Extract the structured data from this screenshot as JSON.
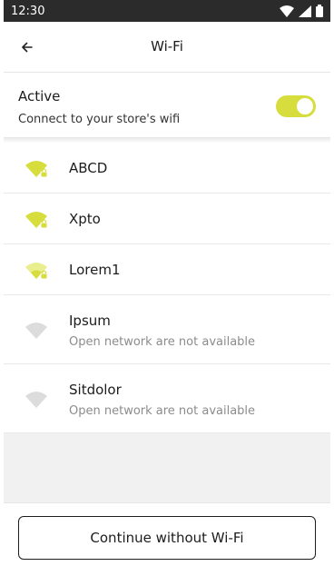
{
  "status_bar": {
    "time": "12:30"
  },
  "header": {
    "title": "Wi-Fi"
  },
  "active": {
    "label": "Active",
    "description": "Connect to your store's wifi",
    "toggle_on": true
  },
  "colors": {
    "accent": "#d6dd3c",
    "accent_light": "#e9ee8f",
    "disabled": "#dcdcdc"
  },
  "networks": [
    {
      "name": "ABCD",
      "subtitle": "",
      "secured": true,
      "signal": "strong"
    },
    {
      "name": "Xpto",
      "subtitle": "",
      "secured": true,
      "signal": "strong"
    },
    {
      "name": "Lorem1",
      "subtitle": "",
      "secured": true,
      "signal": "weak"
    },
    {
      "name": "Ipsum",
      "subtitle": "Open network are not available",
      "secured": false,
      "signal": "disabled"
    },
    {
      "name": "Sitdolor",
      "subtitle": "Open network are not available",
      "secured": false,
      "signal": "disabled"
    }
  ],
  "footer": {
    "continue_label": "Continue without Wi-Fi"
  }
}
